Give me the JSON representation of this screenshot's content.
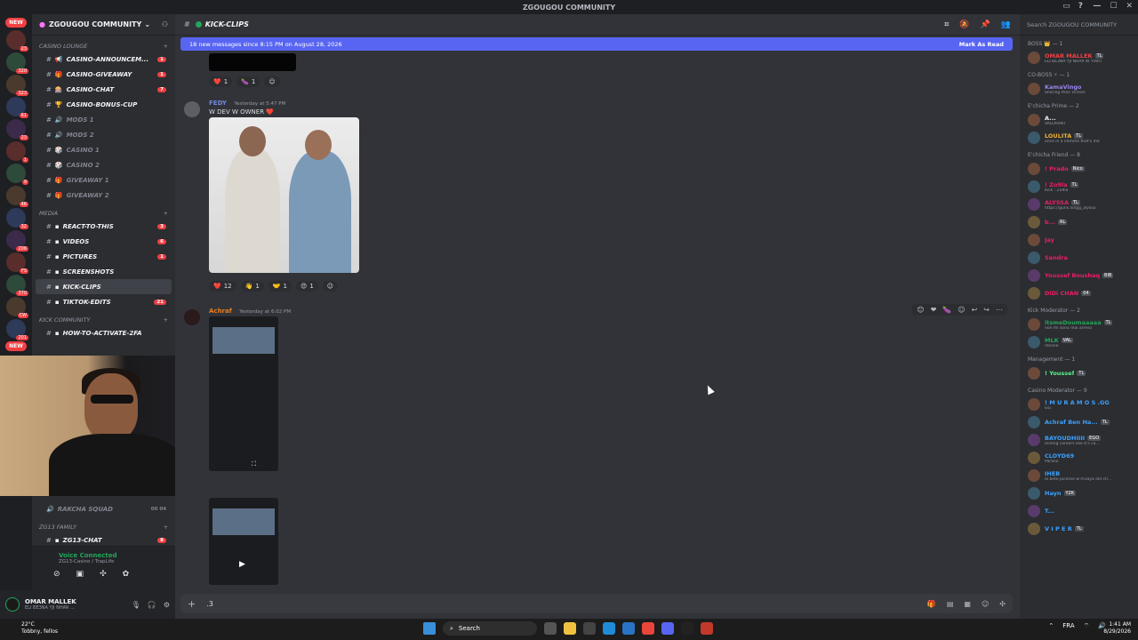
{
  "window": {
    "title": "ZGOUGOU COMMUNITY"
  },
  "servers": [
    {
      "label": "NEW"
    },
    {
      "label": "23"
    },
    {
      "label": "320"
    },
    {
      "label": "323"
    },
    {
      "label": "61"
    },
    {
      "label": "23"
    },
    {
      "label": "1"
    },
    {
      "label": "9"
    },
    {
      "label": "46"
    },
    {
      "label": "32"
    },
    {
      "label": "206"
    },
    {
      "label": "FS"
    },
    {
      "label": "370"
    },
    {
      "label": "CW"
    },
    {
      "label": "201"
    },
    {
      "label": "NEW"
    }
  ],
  "guild": {
    "name": "ZGOUGOU COMMUNITY"
  },
  "categories": {
    "casino": "CASINO LOUNGE",
    "media": "MEDIA",
    "kick": "KICK COMMUNITY",
    "zg13": "ZG13 FAMILY"
  },
  "casino_channels": [
    {
      "name": "CASINO-ANNOUNCEM...",
      "badge": "1",
      "emoji": "📢"
    },
    {
      "name": "CASINO-GIVEAWAY",
      "badge": "1",
      "emoji": "🎁"
    },
    {
      "name": "CASINO-CHAT",
      "badge": "7",
      "emoji": "🎰"
    },
    {
      "name": "CASINO-BONUS-CUP",
      "badge": "",
      "emoji": "🏆"
    },
    {
      "name": "MODS 1",
      "badge": "",
      "emoji": "🔊"
    },
    {
      "name": "MODS 2",
      "badge": "",
      "emoji": "🔊"
    },
    {
      "name": "CASINO 1",
      "badge": "",
      "emoji": "🎲"
    },
    {
      "name": "CASINO 2",
      "badge": "",
      "emoji": "🎲"
    },
    {
      "name": "GIVEAWAY 1",
      "badge": "",
      "emoji": "🎁"
    },
    {
      "name": "GIVEAWAY 2",
      "badge": "",
      "emoji": "🎁"
    }
  ],
  "media_channels": [
    {
      "name": "REACT-TO-THIS",
      "badge": "3"
    },
    {
      "name": "VIDEOS",
      "badge": "6"
    },
    {
      "name": "PICTURES",
      "badge": "1"
    },
    {
      "name": "SCREENSHOTS",
      "badge": ""
    },
    {
      "name": "KICK-CLIPS",
      "badge": ""
    },
    {
      "name": "TIKTOK-EDITS",
      "badge": "21"
    }
  ],
  "kick_channels": [
    {
      "name": "HOW-TO-ACTIVATE-2FA"
    }
  ],
  "voice_squad": {
    "name": "RAKCHA SQUAD",
    "meta": "00 04"
  },
  "zg13_channels": [
    {
      "name": "ZG13-CHAT",
      "badge": "8"
    }
  ],
  "voice": {
    "status": "Voice Connected",
    "channel": "ZG13-Casino / TrapLife"
  },
  "user": {
    "name": "OMAR MALLEK",
    "status": "ELI BE3NA YJI NHAR ..."
  },
  "channel": {
    "name": "KICK-CLIPS"
  },
  "newbar": {
    "text": "18 new messages since 8:15 PM on August 28, 2026",
    "action": "Mark As Read"
  },
  "reactions_top": [
    {
      "e": "❤️",
      "n": "1"
    },
    {
      "e": "🍆",
      "n": "1"
    },
    {
      "e": "☺",
      "n": ""
    }
  ],
  "msg_fedy": {
    "author": "FEDY",
    "tag": "TL",
    "time": "Yesterday at 5:47 PM",
    "text": "W DEV W OWNER ❤️",
    "color": "#7289da"
  },
  "reactions_fedy": [
    {
      "e": "❤️",
      "n": "12"
    },
    {
      "e": "👋",
      "n": "1"
    },
    {
      "e": "🤝",
      "n": "1"
    },
    {
      "e": "😍",
      "n": "1"
    },
    {
      "e": "☺",
      "n": ""
    }
  ],
  "msg_achraf": {
    "author": "Achraf",
    "time": "Yesterday at 6:02 PM",
    "color": "#e67e22"
  },
  "composer": {
    "text": ".3"
  },
  "members": {
    "search": "Search ZGOUGOU COMMUNITY",
    "groups": [
      {
        "role": "BOSS 👑 — 1",
        "items": [
          {
            "name": "OMAR MALLEK",
            "tag": "TL",
            "sub": "ELI BE3NA YJI NHAR W YIART",
            "color": "#f23f43"
          }
        ]
      },
      {
        "role": "CO-BOSS ⚡ — 1",
        "items": [
          {
            "name": "KamaVingo",
            "tag": "",
            "sub": "Sharing their screen",
            "color": "#9b84ee"
          }
        ]
      },
      {
        "role": "E'chicha Prime — 2",
        "items": [
          {
            "name": "A...",
            "tag": "",
            "sub": "VALORANT",
            "color": "#f2f3f5"
          },
          {
            "name": "LOULITA",
            "tag": "TL",
            "sub": "once in a lifetime that's me",
            "color": "#f0b232"
          }
        ]
      },
      {
        "role": "E'chicha Friend — 8",
        "items": [
          {
            "name": "! Prado",
            "tag": "Nico",
            "sub": "",
            "color": "#e91e63"
          },
          {
            "name": "! Zo9la",
            "tag": "TL",
            "sub": "Kick : Zo9la",
            "color": "#e91e63"
          },
          {
            "name": "ALYSSA",
            "tag": "TL",
            "sub": "https://guns.lol/gg_alyssa",
            "color": "#e91e63"
          },
          {
            "name": "b...",
            "tag": "RL",
            "sub": "",
            "color": "#e91e63"
          },
          {
            "name": "Jay",
            "tag": "",
            "sub": "",
            "color": "#e91e63"
          },
          {
            "name": "Sandra",
            "tag": "",
            "sub": "",
            "color": "#e91e63"
          },
          {
            "name": "Youssef Boushaq",
            "tag": "BIB",
            "sub": "",
            "color": "#e91e63"
          },
          {
            "name": "DiDi CHAN",
            "tag": "04",
            "sub": "",
            "color": "#e91e63"
          }
        ]
      },
      {
        "role": "Kick Moderator — 2",
        "items": [
          {
            "name": "itsmeDoumaaaaa",
            "tag": "TL",
            "sub": "non mi sono mai arreso",
            "color": "#23a559"
          },
          {
            "name": "MLK",
            "tag": "VAL",
            "sub": "rdcone",
            "color": "#23a559"
          }
        ]
      },
      {
        "role": "Management — 1",
        "items": [
          {
            "name": "! Youssef",
            "tag": "TL",
            "sub": "",
            "color": "#57f287"
          }
        ]
      },
      {
        "role": "Casino Moderator — 9",
        "items": [
          {
            "name": "! M U R A M O S .GG",
            "tag": "",
            "sub": "GG",
            "color": "#3ba1ff"
          },
          {
            "name": "Achraf Ben Ha...",
            "tag": "TL",
            "sub": "",
            "color": "#3ba1ff"
          },
          {
            "name": "BAYOUDHIIII",
            "tag": "EGO",
            "sub": "ending careers like it's ca...",
            "color": "#3ba1ff"
          },
          {
            "name": "CLOYD69",
            "tag": "",
            "sub": "Parano",
            "color": "#3ba1ff"
          },
          {
            "name": "IHEB",
            "tag": "",
            "sub": "la bete picesse w m3aya old ch...",
            "color": "#3ba1ff"
          },
          {
            "name": "Hayn",
            "tag": "Y2K",
            "sub": "",
            "color": "#3ba1ff"
          },
          {
            "name": "T...",
            "tag": "",
            "sub": "",
            "color": "#3ba1ff"
          },
          {
            "name": "V I P E R",
            "tag": "TL",
            "sub": "",
            "color": "#3ba1ff"
          }
        ]
      }
    ]
  },
  "taskbar": {
    "temp": "22°C",
    "weather": "Tobbny, fellos",
    "search": "Search",
    "lang": "FRA",
    "time": "1:41 AM",
    "date": "8/29/2026"
  }
}
